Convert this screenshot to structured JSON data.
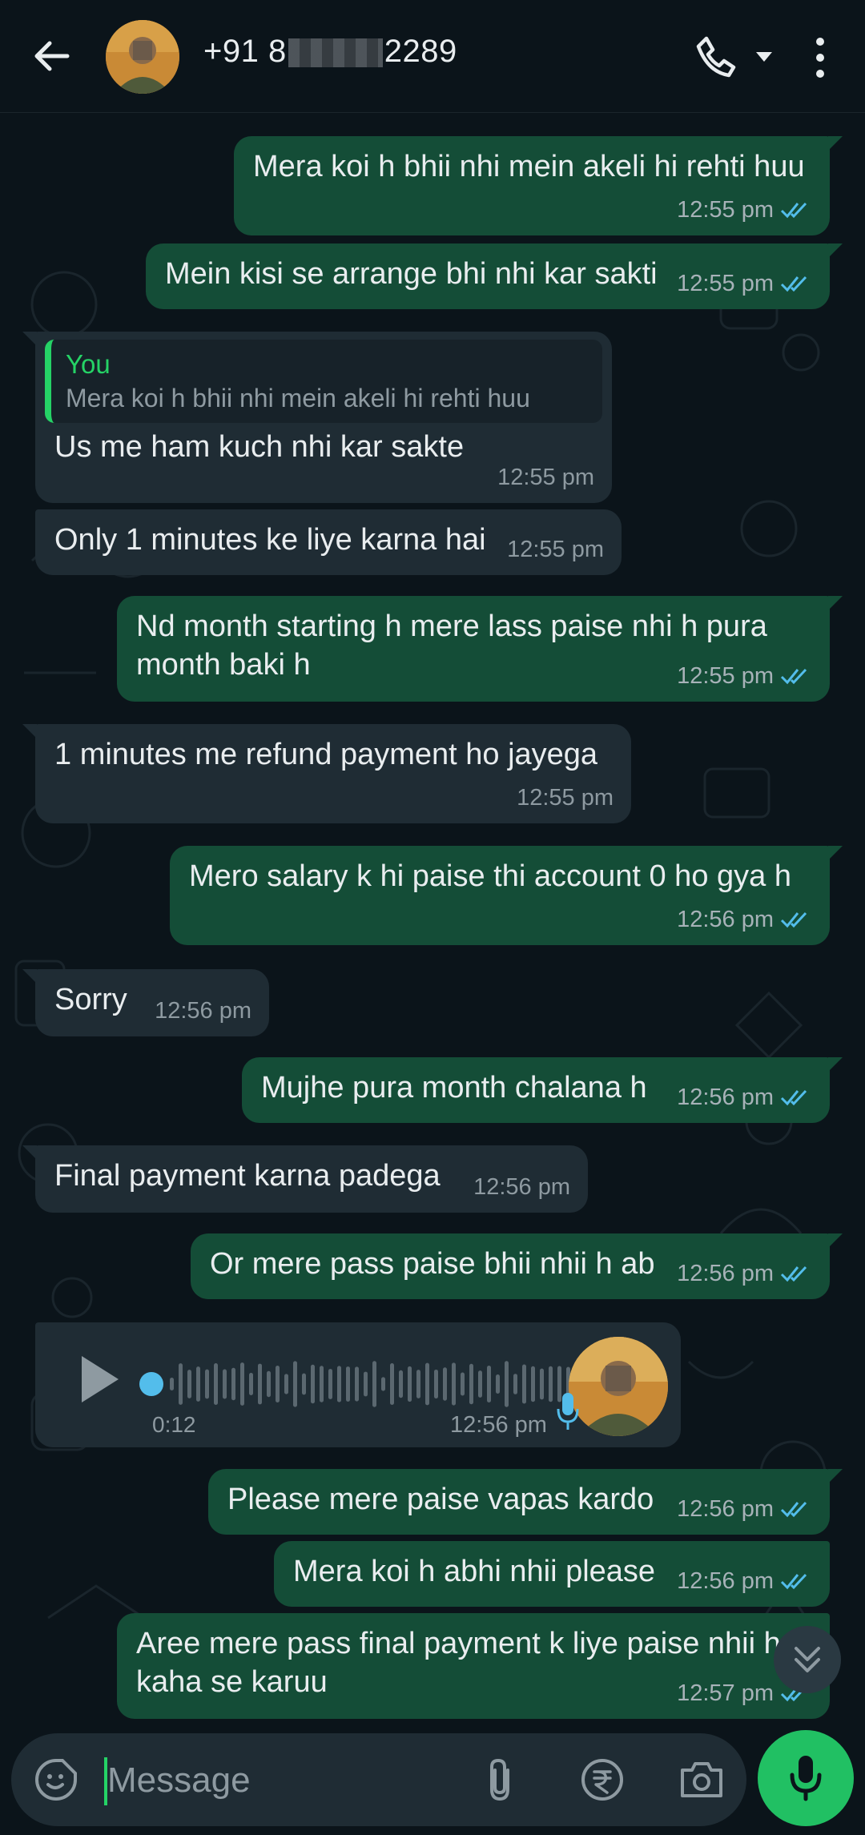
{
  "header": {
    "contact_prefix": "+91 8",
    "contact_suffix": "2289",
    "icons": [
      "back-arrow-icon",
      "phone-icon",
      "chevron-down-icon",
      "more-vert-icon"
    ]
  },
  "messages": [
    {
      "dir": "out",
      "text": "Mera koi h bhii nhi mein akeli hi rehti huu",
      "time": "12:55 pm"
    },
    {
      "dir": "out",
      "text": "Mein kisi se arrange bhi nhi kar sakti",
      "time": "12:55 pm"
    },
    {
      "dir": "in",
      "quote_author": "You",
      "quote_text": "Mera koi h bhii nhi mein akeli hi rehti huu",
      "text": "Us me ham kuch nhi kar sakte",
      "time": "12:55 pm"
    },
    {
      "dir": "in",
      "text": "Only 1 minutes ke liye karna hai",
      "time": "12:55 pm"
    },
    {
      "dir": "out",
      "text": "Nd month starting h mere lass paise nhi h pura month baki h",
      "time": "12:55 pm"
    },
    {
      "dir": "in",
      "text": "1 minutes me refund payment ho jayega",
      "time": "12:55 pm"
    },
    {
      "dir": "out",
      "text": "Mero salary k hi paise thi account 0 ho gya h",
      "time": "12:56 pm"
    },
    {
      "dir": "in",
      "text": "Sorry",
      "time": "12:56 pm"
    },
    {
      "dir": "out",
      "text": "Mujhe pura month chalana h",
      "time": "12:56 pm"
    },
    {
      "dir": "in",
      "text": "Final payment karna padega",
      "time": "12:56 pm"
    },
    {
      "dir": "out",
      "text": "Or mere pass paise bhii nhii h ab",
      "time": "12:56 pm"
    },
    {
      "dir": "in",
      "type": "voice",
      "duration": "0:12",
      "time": "12:56 pm"
    },
    {
      "dir": "out",
      "text": "Please mere paise vapas kardo",
      "time": "12:56 pm"
    },
    {
      "dir": "out",
      "text": "Mera koi h abhi nhii please",
      "time": "12:56 pm"
    },
    {
      "dir": "out",
      "text": "Aree mere pass final payment k liye paise nhii h kaha se karuu",
      "time": "12:57 pm"
    }
  ],
  "composer": {
    "placeholder": "Message",
    "icons": [
      "emoji-icon",
      "attach-icon",
      "rupee-payment-icon",
      "camera-icon",
      "mic-icon"
    ]
  },
  "colors": {
    "background": "#0b141a",
    "outgoing_bubble": "#144d37",
    "incoming_bubble": "#1f2c34",
    "accent": "#25d366",
    "read_ticks": "#53bdeb"
  }
}
